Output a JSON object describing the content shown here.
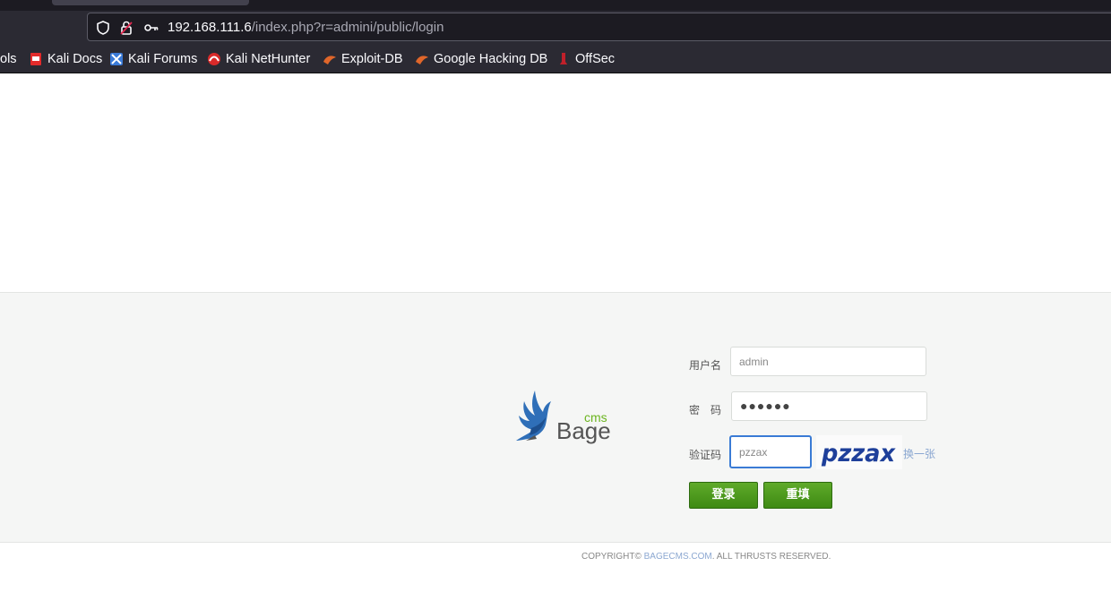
{
  "browser": {
    "url_host": "192.168.111.6",
    "url_path": "/index.php?r=admini/public/login",
    "bookmarks": [
      {
        "label": "ols",
        "icon": "tools-icon"
      },
      {
        "label": "Kali Docs",
        "icon": "kali-docs-icon"
      },
      {
        "label": "Kali Forums",
        "icon": "kali-forums-icon"
      },
      {
        "label": "Kali NetHunter",
        "icon": "kali-nethunter-icon"
      },
      {
        "label": "Exploit-DB",
        "icon": "exploit-db-icon"
      },
      {
        "label": "Google Hacking DB",
        "icon": "ghdb-icon"
      },
      {
        "label": "OffSec",
        "icon": "offsec-icon"
      }
    ]
  },
  "login": {
    "logo_brand": "Bage",
    "logo_sub": "cms",
    "username_label": "用户名",
    "username_value": "admin",
    "password_label": "密　码",
    "password_value": "●●●●●●",
    "captcha_label": "验证码",
    "captcha_value": "pzzax",
    "captcha_image_text": "pzzax",
    "refresh_label": "换一张",
    "login_button": "登录",
    "reset_button": "重填"
  },
  "footer": {
    "prefix": "COPYRIGHT©",
    "link": "BAGECMS.COM",
    "suffix": ". ALL THRUSTS RESERVED."
  },
  "colors": {
    "chrome_bg": "#2b2a33",
    "button_green": "#4a9a1c",
    "link_blue": "#8ba7d1",
    "captcha_blue": "#1e3f9a"
  }
}
